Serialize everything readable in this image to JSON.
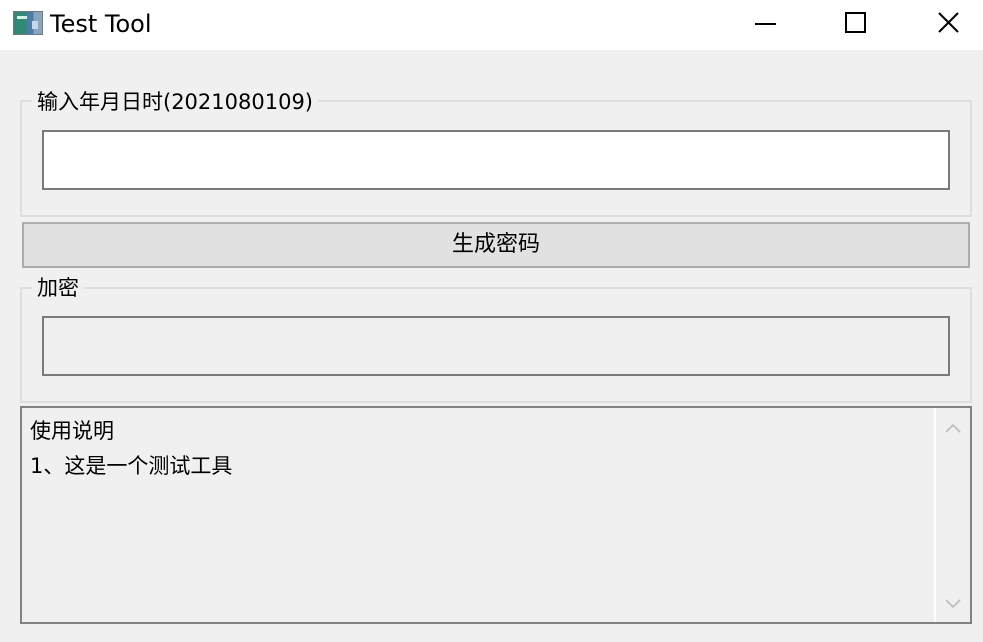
{
  "window": {
    "title": "Test Tool",
    "controls": {
      "minimize": "minimize-icon",
      "maximize": "maximize-icon",
      "close": "close-icon"
    }
  },
  "date_group": {
    "label": "输入年月日时(2021080109)",
    "input_value": ""
  },
  "generate_button": {
    "label": "生成密码"
  },
  "encrypt_group": {
    "label": "加密",
    "output_value": ""
  },
  "instructions": {
    "heading": "使用说明",
    "line1": "1、这是一个测试工具",
    "scroll_up_icon": "chevron-up-icon",
    "scroll_down_icon": "chevron-down-icon"
  }
}
